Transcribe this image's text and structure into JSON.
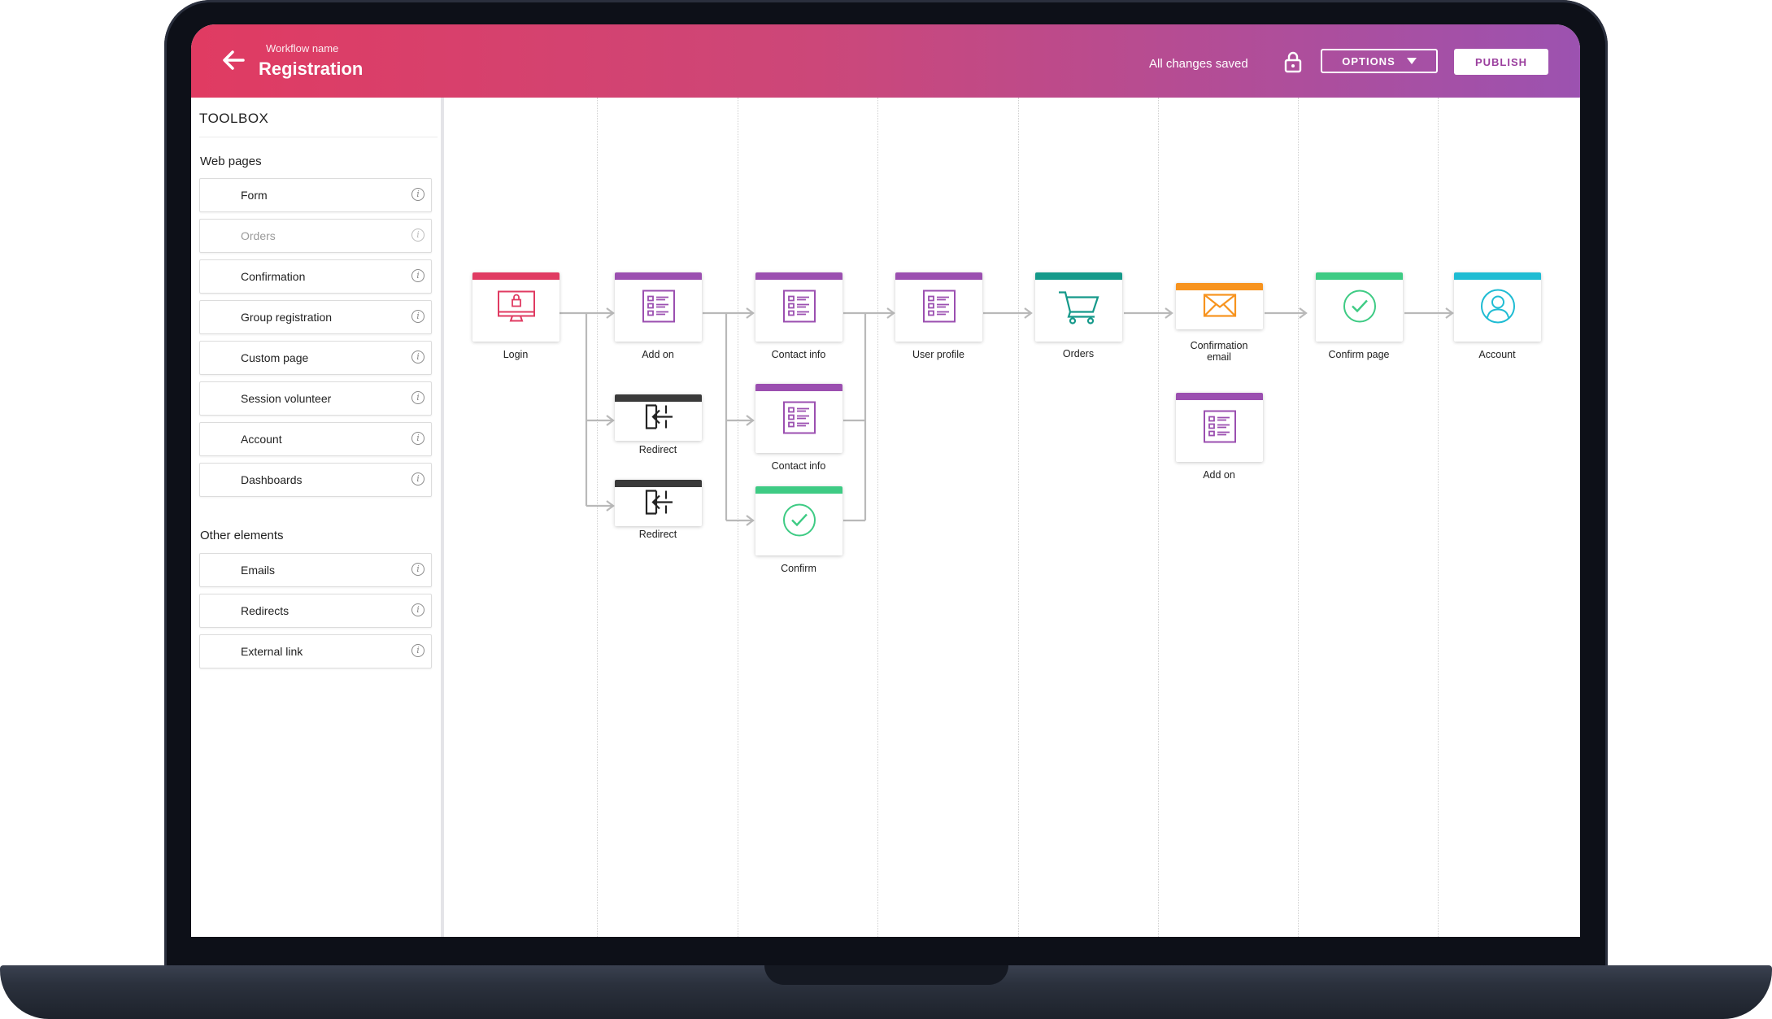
{
  "header": {
    "workflow_label": "Workflow name",
    "title": "Registration",
    "status": "All changes saved",
    "options_label": "OPTIONS",
    "publish_label": "PUBLISH"
  },
  "toolbox": {
    "title": "TOOLBOX",
    "web_pages_heading": "Web pages",
    "web_pages": [
      {
        "label": "Form",
        "disabled": false
      },
      {
        "label": "Orders",
        "disabled": true
      },
      {
        "label": "Confirmation",
        "disabled": false
      },
      {
        "label": "Group registration",
        "disabled": false
      },
      {
        "label": "Custom page",
        "disabled": false
      },
      {
        "label": "Session volunteer",
        "disabled": false
      },
      {
        "label": "Account",
        "disabled": false
      },
      {
        "label": "Dashboards",
        "disabled": false
      }
    ],
    "other_heading": "Other elements",
    "other": [
      {
        "label": "Emails"
      },
      {
        "label": "Redirects"
      },
      {
        "label": "External link"
      }
    ],
    "info_glyph": "i"
  },
  "workflow": {
    "nodes": [
      {
        "label": "Login",
        "icon": "login-icon",
        "color": "#e03b62"
      },
      {
        "label": "Add on",
        "icon": "form-icon",
        "color": "#9b4fb0"
      },
      {
        "label": "Redirect",
        "icon": "redirect-icon",
        "color": "#3a3a3a"
      },
      {
        "label": "Redirect",
        "icon": "redirect-icon",
        "color": "#3a3a3a"
      },
      {
        "label": "Contact info",
        "icon": "form-icon",
        "color": "#9b4fb0"
      },
      {
        "label": "Contact info",
        "icon": "form-icon",
        "color": "#9b4fb0"
      },
      {
        "label": "Confirm",
        "icon": "check-icon",
        "color": "#3ecb84"
      },
      {
        "label": "User profile",
        "icon": "form-icon",
        "color": "#9b4fb0"
      },
      {
        "label": "Orders",
        "icon": "cart-icon",
        "color": "#15998a"
      },
      {
        "label": "Confirmation\nemail",
        "icon": "email-icon",
        "color": "#f7931e"
      },
      {
        "label": "Add on",
        "icon": "form-icon",
        "color": "#9b4fb0"
      },
      {
        "label": "Confirm page",
        "icon": "check-icon",
        "color": "#3ecb84"
      },
      {
        "label": "Account",
        "icon": "account-icon",
        "color": "#1fbcd3"
      }
    ]
  }
}
